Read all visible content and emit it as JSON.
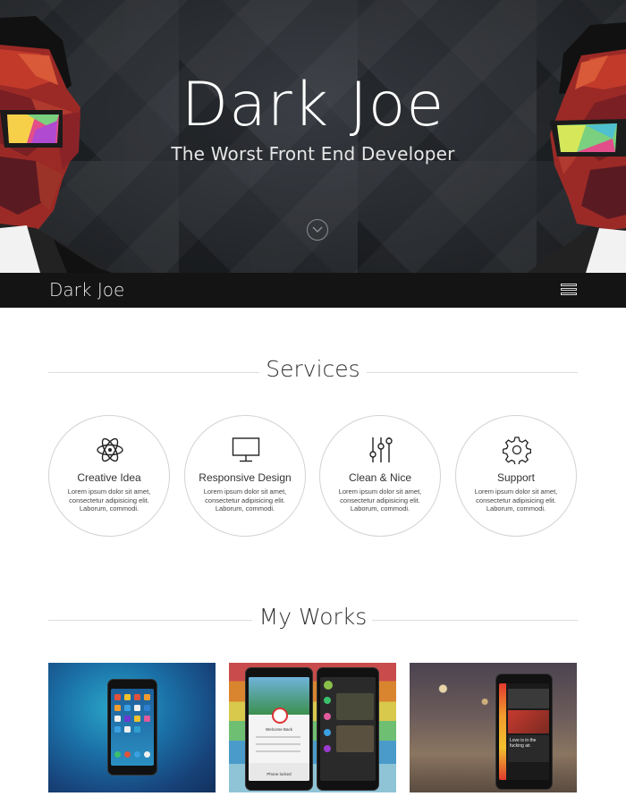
{
  "hero": {
    "title": "Dark Joe",
    "subtitle": "The Worst Front End Developer",
    "scroll_icon": "chevron-down-circle-icon"
  },
  "navbar": {
    "brand": "Dark Joe",
    "menu_icon": "hamburger-menu-icon"
  },
  "services": {
    "title": "Services",
    "items": [
      {
        "title": "Creative Idea",
        "icon": "atom-icon",
        "text_1": "Lorem ipsum dolor sit amet,",
        "text_2": "consectetur adipisicing elit.",
        "text_3": "Laborum, commodi."
      },
      {
        "title": "Responsive Design",
        "icon": "monitor-icon",
        "text_1": "Lorem ipsum dolor sit amet,",
        "text_2": "consectetur adipisicing elit.",
        "text_3": "Laborum, commodi."
      },
      {
        "title": "Clean & Nice",
        "icon": "sliders-icon",
        "text_1": "Lorem ipsum dolor sit amet,",
        "text_2": "consectetur adipisicing elit.",
        "text_3": "Laborum, commodi."
      },
      {
        "title": "Support",
        "icon": "gear-icon",
        "text_1": "Lorem ipsum dolor sit amet,",
        "text_2": "consectetur adipisicing elit.",
        "text_3": "Laborum, commodi."
      }
    ]
  },
  "works": {
    "title": "My Works",
    "items": [
      {
        "image": "phone-homescreen-blue"
      },
      {
        "image": "phones-app-colorful"
      },
      {
        "image": "phone-app-bokeh"
      }
    ],
    "phone_screen": {
      "welcome": "Welcome Back",
      "phone_locked": "Phone locked",
      "love_text": "Love is in the fucking air."
    }
  },
  "colors": {
    "hero_bg": "#2a2d31",
    "navbar_bg": "#141414",
    "rule": "#dddddd",
    "circle_border": "#d3d3d3"
  }
}
